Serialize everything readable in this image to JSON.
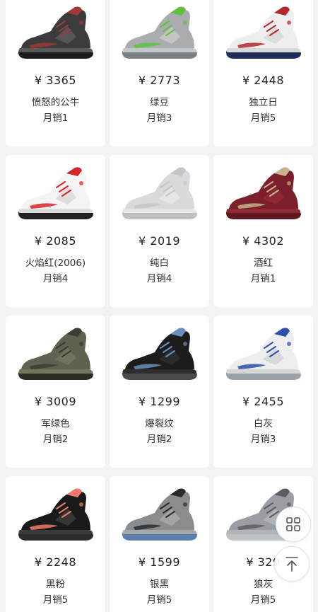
{
  "currency": "¥",
  "products": [
    {
      "price": "3365",
      "name": "愤怒的公牛",
      "sales": "月销1",
      "colors": {
        "upper": "#3b3b3b",
        "accent": "#a03838",
        "sole": "#1b1b1b",
        "mid": "#5a5a5a"
      }
    },
    {
      "price": "2773",
      "name": "绿豆",
      "sales": "月销3",
      "colors": {
        "upper": "#a9adb0",
        "accent": "#5ec23f",
        "sole": "#7b8084",
        "mid": "#c4c7c9"
      }
    },
    {
      "price": "2448",
      "name": "独立日",
      "sales": "月销5",
      "colors": {
        "upper": "#eeeeee",
        "accent": "#b4282d",
        "sole": "#1f2d5a",
        "mid": "#d9d9d9"
      }
    },
    {
      "price": "2085",
      "name": "火焰红(2006)",
      "sales": "月销4",
      "colors": {
        "upper": "#f4f4f4",
        "accent": "#d6242a",
        "sole": "#222222",
        "mid": "#dcdcdc"
      }
    },
    {
      "price": "2019",
      "name": "纯白",
      "sales": "月销4",
      "colors": {
        "upper": "#d8dadc",
        "accent": "#c3c6c9",
        "sole": "#bfc2c4",
        "mid": "#e6e7e8"
      }
    },
    {
      "price": "4302",
      "name": "酒红",
      "sales": "月销1",
      "colors": {
        "upper": "#7a1f2b",
        "accent": "#c9b28c",
        "sole": "#5e1820",
        "mid": "#8e2a35"
      }
    },
    {
      "price": "3009",
      "name": "军绿色",
      "sales": "月销2",
      "colors": {
        "upper": "#5d6350",
        "accent": "#3a3d33",
        "sole": "#2b2d26",
        "mid": "#70755f"
      }
    },
    {
      "price": "1299",
      "name": "爆裂纹",
      "sales": "月销2",
      "colors": {
        "upper": "#1c1c1c",
        "accent": "#6a8fbf",
        "sole": "#4a4a4a",
        "mid": "#2e2e2e"
      }
    },
    {
      "price": "2455",
      "name": "白灰",
      "sales": "月销3",
      "colors": {
        "upper": "#eeeeee",
        "accent": "#2d4fa8",
        "sole": "#9aa0a6",
        "mid": "#d4d6d8"
      }
    },
    {
      "price": "2248",
      "name": "黑粉",
      "sales": "月销5",
      "colors": {
        "upper": "#1a1a1a",
        "accent": "#f07a6a",
        "sole": "#2c2c2c",
        "mid": "#3a3a3a"
      }
    },
    {
      "price": "1599",
      "name": "银黑",
      "sales": "月销5",
      "colors": {
        "upper": "#8a8d90",
        "accent": "#2b2b2b",
        "sole": "#5d7fb0",
        "mid": "#a5a8ab"
      }
    },
    {
      "price": "329",
      "name": "狼灰",
      "sales": "月销5",
      "colors": {
        "upper": "#9a9ea2",
        "accent": "#5a5e62",
        "sole": "#c0c3c6",
        "mid": "#b2b5b8"
      }
    }
  ],
  "floating_buttons": {
    "grid_icon": "grid-icon",
    "back_to_top_icon": "arrow-up-to-top-icon"
  }
}
